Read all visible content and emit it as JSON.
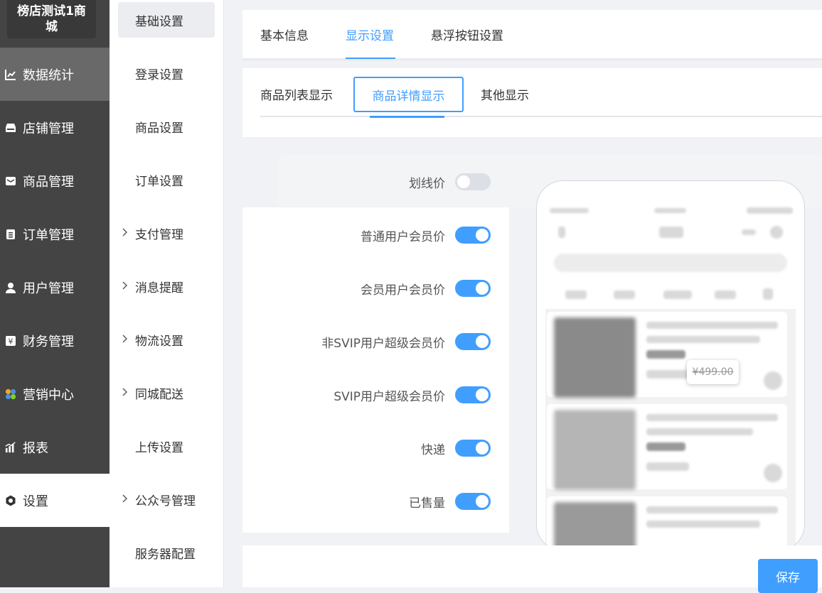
{
  "brand": {
    "line1": "榜店测试1商",
    "line2": "城"
  },
  "sidebar": {
    "items": [
      {
        "label": "数据统计",
        "icon": "line-chart-icon"
      },
      {
        "label": "店铺管理",
        "icon": "store-icon"
      },
      {
        "label": "商品管理",
        "icon": "mail-icon"
      },
      {
        "label": "订单管理",
        "icon": "clipboard-icon"
      },
      {
        "label": "用户管理",
        "icon": "user-icon"
      },
      {
        "label": "财务管理",
        "icon": "yen-icon"
      },
      {
        "label": "营销中心",
        "icon": "marketing-icon"
      },
      {
        "label": "报表",
        "icon": "bar-chart-icon"
      },
      {
        "label": "设置",
        "icon": "gear-icon"
      }
    ]
  },
  "subnav": {
    "items": [
      {
        "label": "基础设置"
      },
      {
        "label": "登录设置"
      },
      {
        "label": "商品设置"
      },
      {
        "label": "订单设置"
      },
      {
        "label": "支付管理"
      },
      {
        "label": "消息提醒"
      },
      {
        "label": "物流设置"
      },
      {
        "label": "同城配送"
      },
      {
        "label": "上传设置"
      },
      {
        "label": "公众号管理"
      },
      {
        "label": "服务器配置"
      }
    ]
  },
  "top_tabs": [
    "基本信息",
    "显示设置",
    "悬浮按钮设置"
  ],
  "sub_tabs": [
    "商品列表显示",
    "商品详情显示",
    "其他显示"
  ],
  "settings": [
    {
      "label": "划线价",
      "on": false
    },
    {
      "label": "普通用户会员价",
      "on": true
    },
    {
      "label": "会员用户会员价",
      "on": true
    },
    {
      "label": "非SVIP用户超级会员价",
      "on": true
    },
    {
      "label": "SVIP用户超级会员价",
      "on": true
    },
    {
      "label": "快递",
      "on": true
    },
    {
      "label": "已售量",
      "on": true
    }
  ],
  "preview": {
    "strike_price": "¥499.00"
  },
  "actions": {
    "save": "保存"
  },
  "colors": {
    "accent": "#409eff",
    "sidebar": "#444444"
  }
}
